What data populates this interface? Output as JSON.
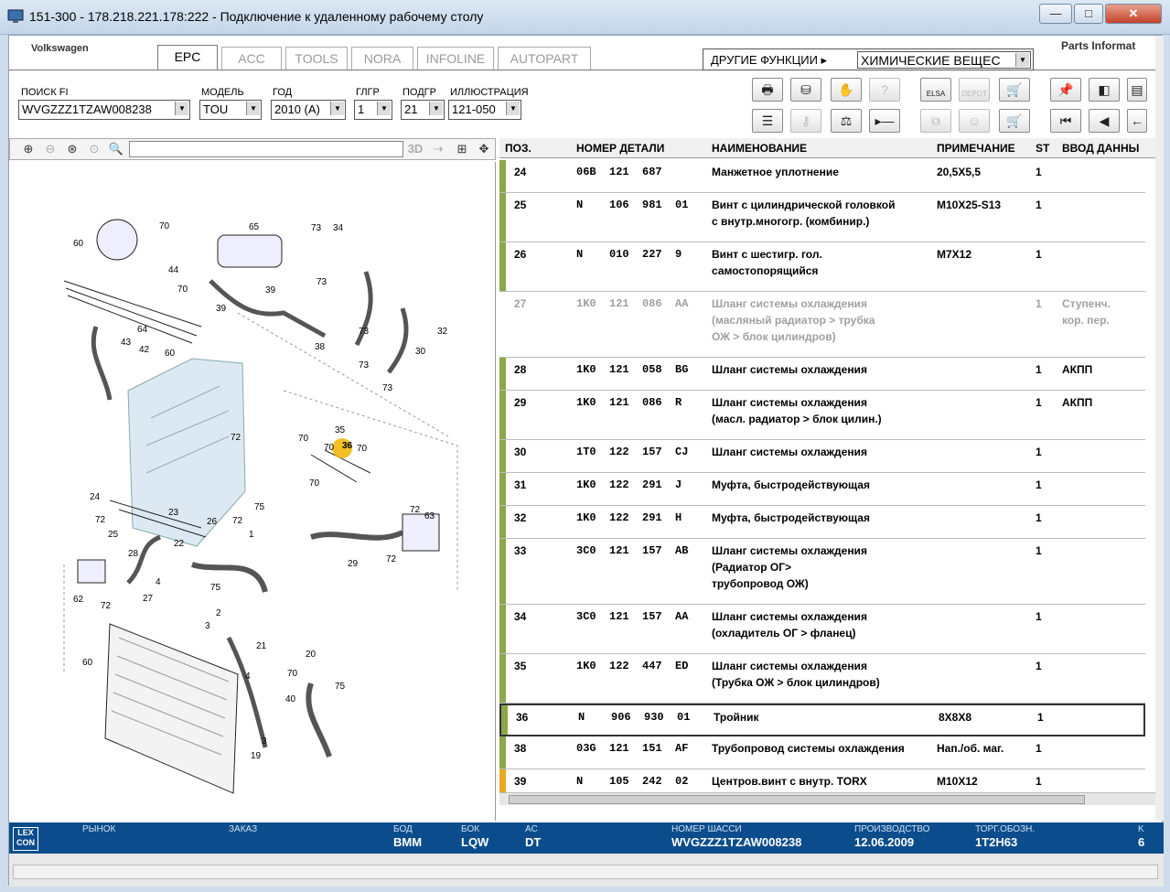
{
  "window": {
    "title": "151-300 - 178.218.221.178:222 - Подключение к удаленному рабочему столу",
    "minimize": "—",
    "maximize": "□",
    "close": "✕"
  },
  "brand": {
    "name": "Volkswagen",
    "parts": "Parts Informat"
  },
  "tabs": [
    "EPC",
    "ACC",
    "TOOLS",
    "NORA",
    "INFOLINE",
    "AUTOPART"
  ],
  "other_functions": {
    "label": "ДРУГИЕ ФУНКЦИИ ▸",
    "value": "ХИМИЧЕСКИЕ ВЕЩЕС"
  },
  "filters": [
    {
      "label": "ПОИСК FI",
      "value": "WVGZZZ1TZAW008238"
    },
    {
      "label": "МОДЕЛЬ",
      "value": "TOU"
    },
    {
      "label": "ГОД",
      "value": "2010 (A)"
    },
    {
      "label": "ГЛГР",
      "value": "1"
    },
    {
      "label": "ПОДГР",
      "value": "21"
    },
    {
      "label": "ИЛЛЮСТРАЦИЯ",
      "value": "121-050"
    }
  ],
  "toolbar_icons": {
    "elsa": "ELSA",
    "depot": "DEPOT"
  },
  "table": {
    "headers": [
      "ПОЗ.",
      "НОМЕР ДЕТАЛИ",
      "НАИМЕНОВАНИЕ",
      "ПРИМЕЧАНИЕ",
      "ST",
      "ВВОД ДАННЫ"
    ],
    "rows": [
      {
        "pos": "24",
        "p1": "06B",
        "p2": "121",
        "p3": "687",
        "p4": "",
        "name1": "Манжетное уплотнение",
        "name2": "",
        "name3": "",
        "note": "20,5X5,5",
        "st": "1",
        "input1": "",
        "input2": ""
      },
      {
        "pos": "25",
        "p1": "N",
        "p2": "106",
        "p3": "981",
        "p4": "01",
        "name1": "Винт с цилиндрической головкой",
        "name2": "с внутр.многогр. (комбинир.)",
        "name3": "",
        "note": "M10X25-S13",
        "st": "1",
        "input1": "",
        "input2": ""
      },
      {
        "pos": "26",
        "p1": "N",
        "p2": "010",
        "p3": "227",
        "p4": "9",
        "name1": "Винт с шестигр. гол.",
        "name2": "самостопорящийся",
        "name3": "",
        "note": "M7X12",
        "st": "1",
        "input1": "",
        "input2": ""
      },
      {
        "pos": "27",
        "p1": "1K0",
        "p2": "121",
        "p3": "086",
        "p4": "AA",
        "name1": "Шланг системы охлаждения",
        "name2": "(масляный радиатор > трубка",
        "name3": "ОЖ > блок цилиндров)",
        "note": "",
        "st": "1",
        "input1": "Ступенч.",
        "input2": "кор. пер."
      },
      {
        "pos": "28",
        "p1": "1K0",
        "p2": "121",
        "p3": "058",
        "p4": "BG",
        "name1": "Шланг системы охлаждения",
        "name2": "",
        "name3": "",
        "note": "",
        "st": "1",
        "input1": "АКПП",
        "input2": ""
      },
      {
        "pos": "29",
        "p1": "1K0",
        "p2": "121",
        "p3": "086",
        "p4": "R",
        "name1": "Шланг системы охлаждения",
        "name2": "(масл. радиатор > блок цилин.)",
        "name3": "",
        "note": "",
        "st": "1",
        "input1": "АКПП",
        "input2": ""
      },
      {
        "pos": "30",
        "p1": "1T0",
        "p2": "122",
        "p3": "157",
        "p4": "CJ",
        "name1": "Шланг системы охлаждения",
        "name2": "",
        "name3": "",
        "note": "",
        "st": "1",
        "input1": "",
        "input2": ""
      },
      {
        "pos": "31",
        "p1": "1K0",
        "p2": "122",
        "p3": "291",
        "p4": "J",
        "name1": "Муфта, быстродействующая",
        "name2": "",
        "name3": "",
        "note": "",
        "st": "1",
        "input1": "",
        "input2": ""
      },
      {
        "pos": "32",
        "p1": "1K0",
        "p2": "122",
        "p3": "291",
        "p4": "H",
        "name1": "Муфта, быстродействующая",
        "name2": "",
        "name3": "",
        "note": "",
        "st": "1",
        "input1": "",
        "input2": ""
      },
      {
        "pos": "33",
        "p1": "3C0",
        "p2": "121",
        "p3": "157",
        "p4": "AB",
        "name1": "Шланг системы охлаждения",
        "name2": "(Радиатор ОГ>",
        "name3": "трубопровод ОЖ)",
        "note": "",
        "st": "1",
        "input1": "",
        "input2": ""
      },
      {
        "pos": "34",
        "p1": "3C0",
        "p2": "121",
        "p3": "157",
        "p4": "AA",
        "name1": "Шланг системы охлаждения",
        "name2": "(охладитель ОГ > фланец)",
        "name3": "",
        "note": "",
        "st": "1",
        "input1": "",
        "input2": ""
      },
      {
        "pos": "35",
        "p1": "1K0",
        "p2": "122",
        "p3": "447",
        "p4": "ED",
        "name1": "Шланг системы охлаждения",
        "name2": "(Трубка ОЖ > блок цилиндров)",
        "name3": "",
        "note": "",
        "st": "1",
        "input1": "",
        "input2": ""
      },
      {
        "pos": "36",
        "p1": "N",
        "p2": "906",
        "p3": "930",
        "p4": "01",
        "name1": "Тройник",
        "name2": "",
        "name3": "",
        "note": "8X8X8",
        "st": "1",
        "input1": "",
        "input2": ""
      },
      {
        "pos": "38",
        "p1": "03G",
        "p2": "121",
        "p3": "151",
        "p4": "AF",
        "name1": "Трубопровод системы охлаждения",
        "name2": "",
        "name3": "",
        "note": "Нап./об. маг.",
        "st": "1",
        "input1": "",
        "input2": ""
      },
      {
        "pos": "39",
        "p1": "N",
        "p2": "105",
        "p3": "242",
        "p4": "02",
        "name1": "Центров.винт с внутр. TORX",
        "name2": "",
        "name3": "",
        "note": "M10X12",
        "st": "1",
        "input1": "",
        "input2": ""
      }
    ]
  },
  "colors": {
    "green_bar": "#8aa84a",
    "orange_bar": "#e8a820",
    "gray_bar": "#ffffff",
    "status_bg": "#0b4d8c",
    "highlight": "#f0b400"
  },
  "status": {
    "logo": "LEX CON",
    "items": [
      {
        "label": "РЫНОК",
        "value": ""
      },
      {
        "label": "ЗАКАЗ",
        "value": ""
      },
      {
        "label": "БОД",
        "value": "BMM"
      },
      {
        "label": "БОК",
        "value": "LQW"
      },
      {
        "label": "AC",
        "value": "DT"
      },
      {
        "label": "НОМЕР ШАССИ",
        "value": "WVGZZZ1TZAW008238"
      },
      {
        "label": "ПРОИЗВОДСТВО",
        "value": "12.06.2009"
      },
      {
        "label": "ТОРГ.ОБОЗН.",
        "value": "1T2H63"
      },
      {
        "label": "K",
        "value": "6"
      }
    ]
  },
  "diagram": {
    "labels": [
      "60",
      "70",
      "44",
      "70",
      "39",
      "65",
      "73",
      "34",
      "73",
      "39",
      "38",
      "73",
      "73",
      "32",
      "30",
      "72",
      "64",
      "43",
      "42",
      "60",
      "73",
      "72",
      "35",
      "36",
      "70",
      "70",
      "70",
      "70",
      "24",
      "72",
      "25",
      "23",
      "22",
      "26",
      "75",
      "1",
      "72",
      "63",
      "29",
      "72",
      "28",
      "62",
      "72",
      "27",
      "4",
      "75",
      "2",
      "3",
      "21",
      "70",
      "20",
      "75",
      "60",
      "4",
      "19",
      "3",
      "40"
    ],
    "highlight": "36",
    "code_label": "3D"
  }
}
